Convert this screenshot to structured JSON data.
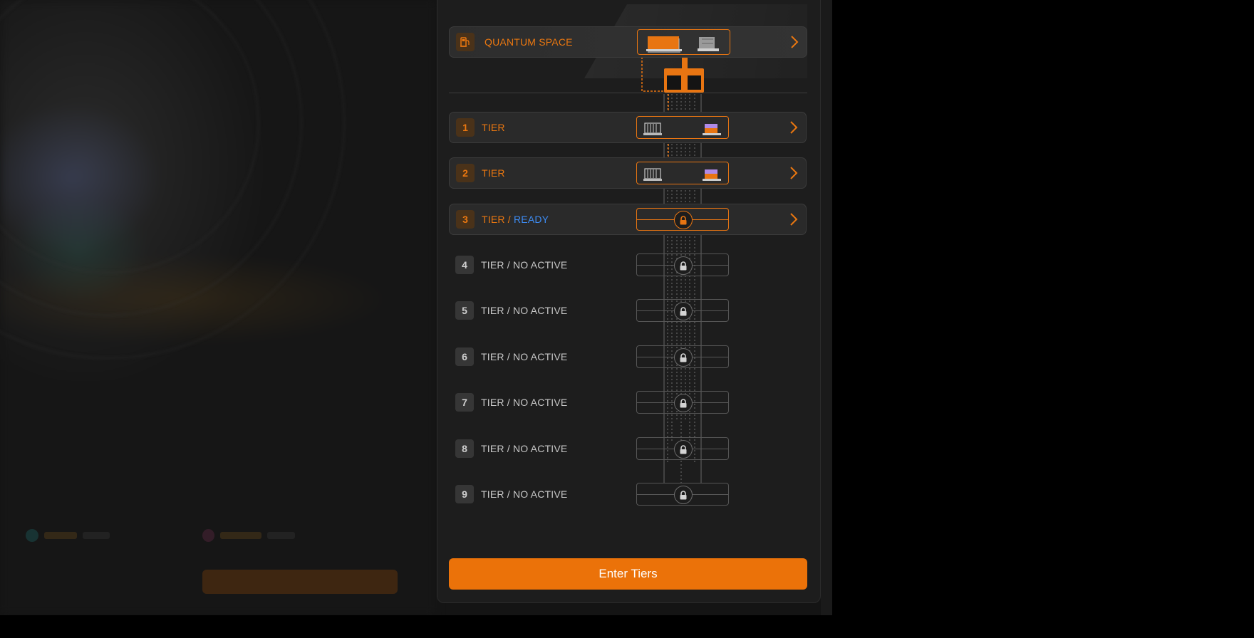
{
  "quantum": {
    "label": "QUANTUM SPACE",
    "icon": "fuel-pump-icon"
  },
  "tiers": [
    {
      "number": "1",
      "label": "TIER",
      "status": "",
      "state": "active"
    },
    {
      "number": "2",
      "label": "TIER",
      "status": "",
      "state": "active"
    },
    {
      "number": "3",
      "label": "TIER / ",
      "status": "READY",
      "state": "active"
    },
    {
      "number": "4",
      "label": "TIER / NO ACTIVE",
      "status": "",
      "state": "inactive"
    },
    {
      "number": "5",
      "label": "TIER / NO ACTIVE",
      "status": "",
      "state": "inactive"
    },
    {
      "number": "6",
      "label": "TIER / NO ACTIVE",
      "status": "",
      "state": "inactive"
    },
    {
      "number": "7",
      "label": "TIER / NO ACTIVE",
      "status": "",
      "state": "inactive"
    },
    {
      "number": "8",
      "label": "TIER / NO ACTIVE",
      "status": "",
      "state": "inactive"
    },
    {
      "number": "9",
      "label": "TIER / NO ACTIVE",
      "status": "",
      "state": "inactive"
    }
  ],
  "enter_button": {
    "label": "Enter Tiers"
  },
  "colors": {
    "accent": "#eb7209",
    "ready": "#3d8bf2",
    "panel": "#1d1d1d",
    "inactive_text": "#c8c8c8"
  }
}
